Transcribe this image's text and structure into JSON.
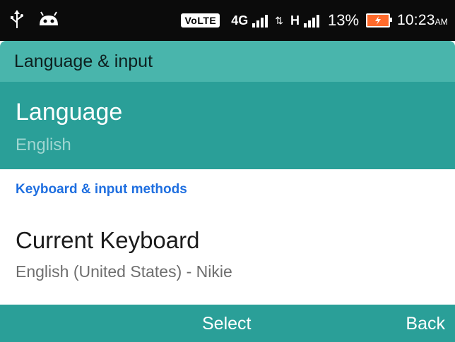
{
  "status_bar": {
    "volte": "VoLTE",
    "net1": "4G",
    "net2": "H",
    "battery": "13%",
    "time": "10:23",
    "ampm": "AM",
    "icons": [
      "usb-icon",
      "android-icon",
      "signal-icon",
      "battery-charging-icon"
    ]
  },
  "title": "Language & input",
  "items": [
    {
      "title": "Language",
      "subtitle": "English",
      "selected": true
    }
  ],
  "section_header": "Keyboard & input methods",
  "keyboard_item": {
    "title": "Current Keyboard",
    "subtitle": "English (United States) - Nikie"
  },
  "softkeys": {
    "center": "Select",
    "right": "Back"
  },
  "colors": {
    "accent": "#2a9f98",
    "titlebar": "#49b5ac",
    "section": "#1f6fe0"
  }
}
